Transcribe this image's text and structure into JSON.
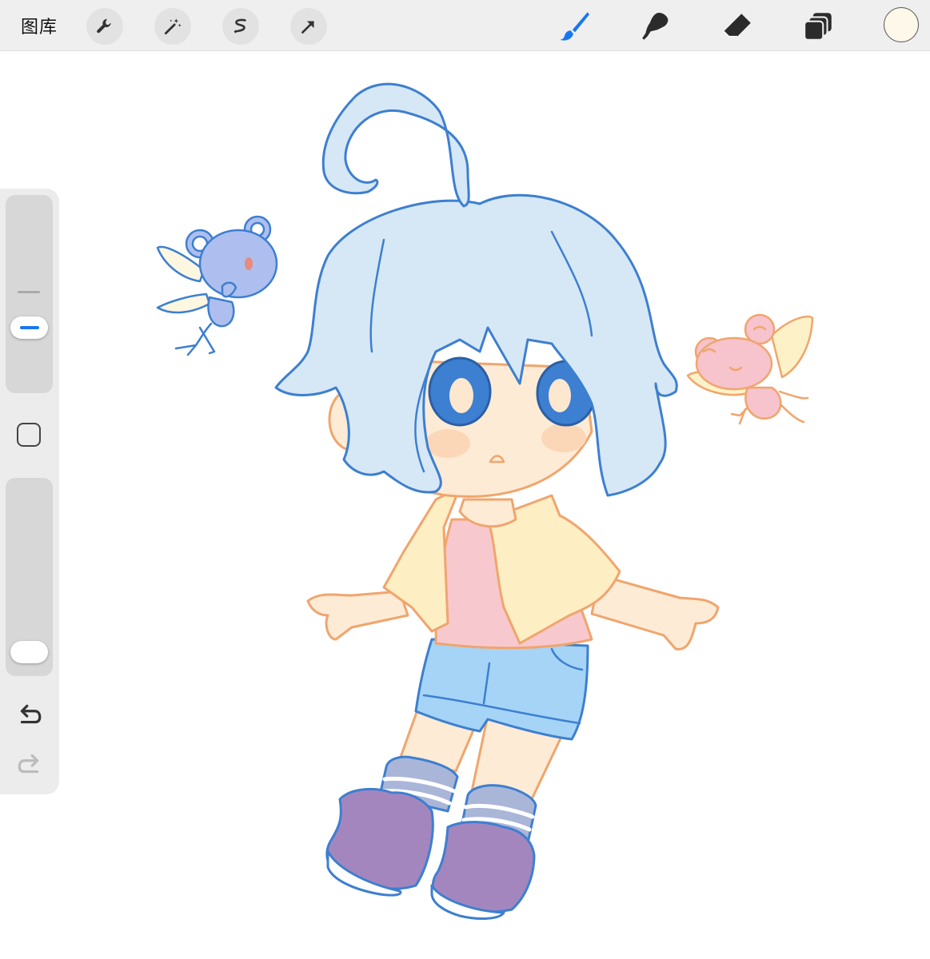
{
  "toolbar": {
    "gallery_label": "图库",
    "left_tools": [
      "wrench-icon",
      "magic-wand-icon",
      "selection-icon",
      "transform-arrow-icon"
    ],
    "right_tools": [
      "brush-icon",
      "smudge-icon",
      "eraser-icon",
      "layers-icon"
    ],
    "active_tool": "brush-icon",
    "current_color": "#fdf8ea",
    "accent_color": "#1877f2"
  },
  "sidebar": {
    "brush_size": 0.3,
    "opacity": 0.05,
    "tools": [
      "modify-square-icon",
      "undo-icon",
      "redo-icon"
    ]
  }
}
